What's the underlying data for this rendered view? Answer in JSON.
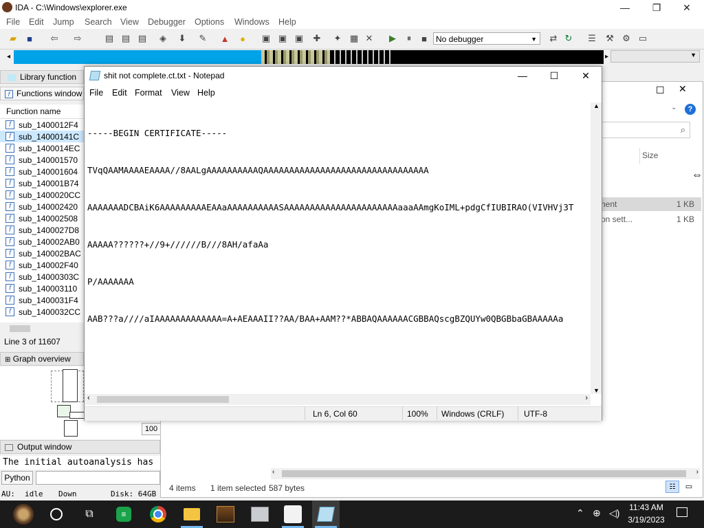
{
  "ida": {
    "title": "IDA - C:\\Windows\\explorer.exe",
    "menu": [
      "File",
      "Edit",
      "Jump",
      "Search",
      "View",
      "Debugger",
      "Options",
      "Windows",
      "Help"
    ],
    "debugger_select": "No debugger",
    "library_tab": "Library function",
    "functions_tab": "Functions window",
    "function_header": "Function name",
    "functions": [
      "sub_1400012F4",
      "sub_14000141C",
      "sub_1400014EC",
      "sub_140001570",
      "sub_140001604",
      "sub_140001B74",
      "sub_1400020CC",
      "sub_140002420",
      "sub_140002508",
      "sub_1400027D8",
      "sub_140002AB0",
      "sub_140002BAC",
      "sub_140002F40",
      "sub_14000303C",
      "sub_140003110",
      "sub_1400031F4",
      "sub_1400032CC"
    ],
    "line_info": "Line 3 of 11607",
    "graph_tab": "Graph overview",
    "graph_zoom": "100",
    "output_tab": "Output window",
    "output_text": "The initial autoanalysis has",
    "python_label": "Python",
    "status": {
      "au": "AU:",
      "state": "idle",
      "dir": "Down",
      "disk": "Disk: 64GB"
    }
  },
  "notepad": {
    "title": "shit not complete.ct.txt - Notepad",
    "menu": [
      "File",
      "Edit",
      "Format",
      "View",
      "Help"
    ],
    "lines": [
      "-----BEGIN CERTIFICATE-----",
      "TVqQAAMAAAAEAAAA//8AALgAAAAAAAAAAQAAAAAAAAAAAAAAAAAAAAAAAAAAAAAAAA",
      "AAAAAAADCBAiK6AAAAAAAAAEAAaAAAAAAAAAASAAAAAAAAAAAAAAAAAAAAAAaaaAAmgKoIML+pdgCfIUBIRAO(VIVHVj3T",
      "AAAAA??????+//9+//////B///8AH/afaAa",
      "P/AAAAAAA",
      "AAB???a////aIAAAAAAAAAAAAA=A+AEAAAII??AA/BAA+AAM??*ABBAQAAAAAACGBBAQscgBZQUYw0QBGBbaGBAAAAAa"
    ],
    "status": {
      "position": "Ln 6, Col 60",
      "zoom": "100%",
      "eol": "Windows (CRLF)",
      "encoding": "UTF-8"
    }
  },
  "explorer": {
    "size_header": "Size",
    "rows": [
      {
        "name": "nent",
        "size": "1 KB"
      },
      {
        "name": "on sett...",
        "size": "1 KB"
      }
    ],
    "status": {
      "items": "4 items",
      "selected": "1 item selected",
      "bytes": "587 bytes"
    }
  },
  "taskbar": {
    "time": "11:43 AM",
    "date": "3/19/2023"
  },
  "colors": {
    "nav_cyan": "#00a2e8",
    "taskbar": "#1b1b1b",
    "accent_blue": "#1e6fd9"
  }
}
